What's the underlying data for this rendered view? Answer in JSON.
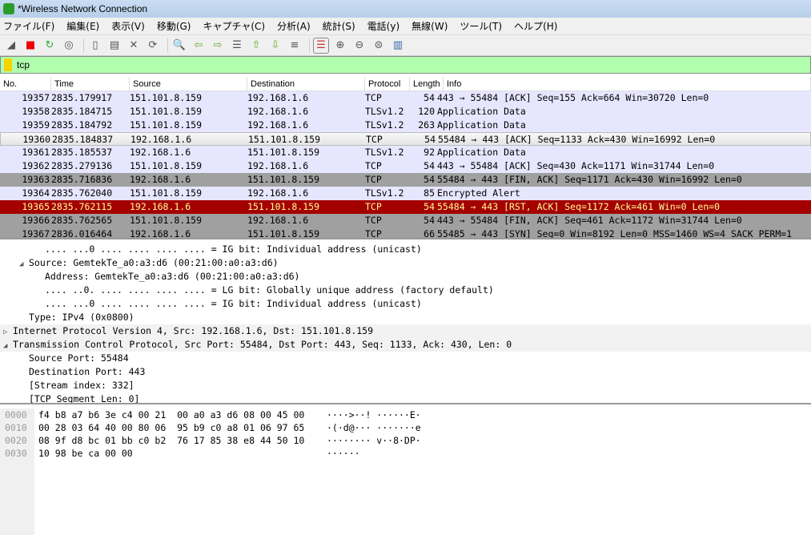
{
  "window": {
    "title": "*Wireless Network Connection"
  },
  "menu": [
    "ファイル(F)",
    "編集(E)",
    "表示(V)",
    "移動(G)",
    "キャプチャ(C)",
    "分析(A)",
    "統計(S)",
    "電話(y)",
    "無線(W)",
    "ツール(T)",
    "ヘルプ(H)"
  ],
  "toolbar": [
    {
      "icon": "shark-fin-start-icon",
      "glyph": "◢"
    },
    {
      "icon": "stop-capture-icon",
      "glyph": "■"
    },
    {
      "icon": "restart-capture-icon",
      "glyph": "↻"
    },
    {
      "icon": "capture-options-icon",
      "glyph": "◎"
    },
    {
      "icon": "open-file-icon",
      "glyph": "▯"
    },
    {
      "icon": "save-file-icon",
      "glyph": "▤"
    },
    {
      "icon": "close-file-icon",
      "glyph": "✕"
    },
    {
      "icon": "reload-file-icon",
      "glyph": "⟳"
    },
    {
      "icon": "find-packet-icon",
      "glyph": "🔍"
    },
    {
      "icon": "go-back-icon",
      "glyph": "⇦"
    },
    {
      "icon": "go-forward-icon",
      "glyph": "⇨"
    },
    {
      "icon": "go-to-packet-icon",
      "glyph": "☰"
    },
    {
      "icon": "first-packet-icon",
      "glyph": "⇧"
    },
    {
      "icon": "last-packet-icon",
      "glyph": "⇩"
    },
    {
      "icon": "autoscroll-icon",
      "glyph": "≡"
    },
    {
      "icon": "colorize-icon",
      "glyph": "☰"
    },
    {
      "icon": "zoom-in-icon",
      "glyph": "⊕"
    },
    {
      "icon": "zoom-out-icon",
      "glyph": "⊖"
    },
    {
      "icon": "zoom-reset-icon",
      "glyph": "⊜"
    },
    {
      "icon": "resize-columns-icon",
      "glyph": "▥"
    }
  ],
  "filter": {
    "value": "tcp"
  },
  "columns": [
    "No.",
    "Time",
    "Source",
    "Destination",
    "Protocol",
    "Length",
    "Info"
  ],
  "packets": [
    {
      "no": "19357",
      "time": "2835.179917",
      "src": "151.101.8.159",
      "dst": "192.168.1.6",
      "proto": "TCP",
      "len": "54",
      "info": "443 → 55484 [ACK] Seq=155 Ack=664 Win=30720 Len=0",
      "style": "normal"
    },
    {
      "no": "19358",
      "time": "2835.184715",
      "src": "151.101.8.159",
      "dst": "192.168.1.6",
      "proto": "TLSv1.2",
      "len": "120",
      "info": "Application Data",
      "style": "normal"
    },
    {
      "no": "19359",
      "time": "2835.184792",
      "src": "151.101.8.159",
      "dst": "192.168.1.6",
      "proto": "TLSv1.2",
      "len": "263",
      "info": "Application Data",
      "style": "normal"
    },
    {
      "no": "19360",
      "time": "2835.184837",
      "src": "192.168.1.6",
      "dst": "151.101.8.159",
      "proto": "TCP",
      "len": "54",
      "info": "55484 → 443 [ACK] Seq=1133 Ack=430 Win=16992 Len=0",
      "style": "sel"
    },
    {
      "no": "19361",
      "time": "2835.185537",
      "src": "192.168.1.6",
      "dst": "151.101.8.159",
      "proto": "TLSv1.2",
      "len": "92",
      "info": "Application Data",
      "style": "normal"
    },
    {
      "no": "19362",
      "time": "2835.279136",
      "src": "151.101.8.159",
      "dst": "192.168.1.6",
      "proto": "TCP",
      "len": "54",
      "info": "443 → 55484 [ACK] Seq=430 Ack=1171 Win=31744 Len=0",
      "style": "normal"
    },
    {
      "no": "19363",
      "time": "2835.716836",
      "src": "192.168.1.6",
      "dst": "151.101.8.159",
      "proto": "TCP",
      "len": "54",
      "info": "55484 → 443 [FIN, ACK] Seq=1171 Ack=430 Win=16992 Len=0",
      "style": "fin"
    },
    {
      "no": "19364",
      "time": "2835.762040",
      "src": "151.101.8.159",
      "dst": "192.168.1.6",
      "proto": "TLSv1.2",
      "len": "85",
      "info": "Encrypted Alert",
      "style": "normal"
    },
    {
      "no": "19365",
      "time": "2835.762115",
      "src": "192.168.1.6",
      "dst": "151.101.8.159",
      "proto": "TCP",
      "len": "54",
      "info": "55484 → 443 [RST, ACK] Seq=1172 Ack=461 Win=0 Len=0",
      "style": "rst"
    },
    {
      "no": "19366",
      "time": "2835.762565",
      "src": "151.101.8.159",
      "dst": "192.168.1.6",
      "proto": "TCP",
      "len": "54",
      "info": "443 → 55484 [FIN, ACK] Seq=461 Ack=1172 Win=31744 Len=0",
      "style": "fin"
    },
    {
      "no": "19367",
      "time": "2836.016464",
      "src": "192.168.1.6",
      "dst": "151.101.8.159",
      "proto": "TCP",
      "len": "66",
      "info": "55485 → 443 [SYN] Seq=0 Win=8192 Len=0 MSS=1460 WS=4 SACK_PERM=1",
      "style": "fin"
    }
  ],
  "colors": {
    "normal": "#e7e6ff",
    "fin": "#a0a0a0",
    "rst_bg": "#a40000",
    "rst_fg": "#fffc9c",
    "filter_ok": "#afffaf"
  },
  "details": [
    {
      "indent": 3,
      "arrow": "",
      "text": ".... ...0 .... .... .... .... = IG bit: Individual address (unicast)"
    },
    {
      "indent": 2,
      "arrow": "open",
      "text": "Source: GemtekTe_a0:a3:d6 (00:21:00:a0:a3:d6)"
    },
    {
      "indent": 3,
      "arrow": "",
      "text": "Address: GemtekTe_a0:a3:d6 (00:21:00:a0:a3:d6)"
    },
    {
      "indent": 3,
      "arrow": "",
      "text": ".... ..0. .... .... .... .... = LG bit: Globally unique address (factory default)"
    },
    {
      "indent": 3,
      "arrow": "",
      "text": ".... ...0 .... .... .... .... = IG bit: Individual address (unicast)"
    },
    {
      "indent": 2,
      "arrow": "",
      "text": "Type: IPv4 (0x0800)"
    },
    {
      "indent": 1,
      "arrow": "closed",
      "text": "Internet Protocol Version 4, Src: 192.168.1.6, Dst: 151.101.8.159"
    },
    {
      "indent": 1,
      "arrow": "open",
      "text": "Transmission Control Protocol, Src Port: 55484, Dst Port: 443, Seq: 1133, Ack: 430, Len: 0"
    },
    {
      "indent": 2,
      "arrow": "",
      "text": "Source Port: 55484"
    },
    {
      "indent": 2,
      "arrow": "",
      "text": "Destination Port: 443"
    },
    {
      "indent": 2,
      "arrow": "",
      "text": "[Stream index: 332]"
    },
    {
      "indent": 2,
      "arrow": "",
      "text": "[TCP Segment Len: 0]"
    }
  ],
  "hex": [
    {
      "offset": "0000",
      "bytes": "f4 b8 a7 b6 3e c4 00 21  00 a0 a3 d6 08 00 45 00",
      "ascii": "····>··! ······E·"
    },
    {
      "offset": "0010",
      "bytes": "00 28 03 64 40 00 80 06  95 b9 c0 a8 01 06 97 65",
      "ascii": "·(·d@··· ·······e"
    },
    {
      "offset": "0020",
      "bytes": "08 9f d8 bc 01 bb c0 b2  76 17 85 38 e8 44 50 10",
      "ascii": "········ v··8·DP·"
    },
    {
      "offset": "0030",
      "bytes": "10 98 be ca 00 00",
      "ascii": "······"
    }
  ]
}
